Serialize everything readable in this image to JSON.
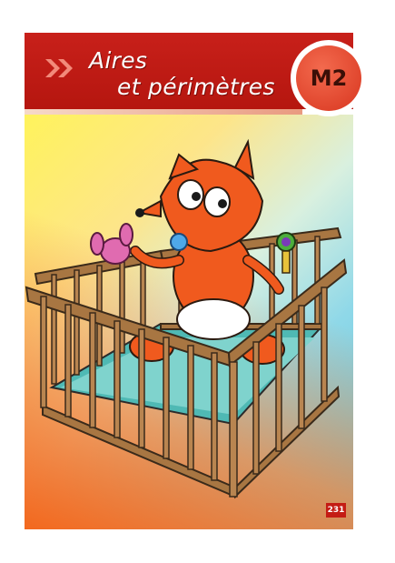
{
  "chapter": {
    "title_line_1": "Aires",
    "title_line_2": "et périmètres",
    "code": "M2"
  },
  "page": {
    "number": "231"
  },
  "illustration": {
    "subject": "fox-baby-in-crib-illustration"
  },
  "colors": {
    "banner_red": "#c41c14",
    "badge_orange": "#e8452c",
    "background_yellow": "#fff35c",
    "background_cyan": "#5ec2dc",
    "background_orange": "#f3681e"
  }
}
